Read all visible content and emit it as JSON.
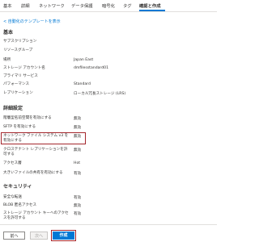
{
  "tabs": [
    "基本",
    "詳細",
    "ネットワーク",
    "データ保護",
    "暗号化",
    "タグ",
    "確認と作成"
  ],
  "template_link": "< 自動化のテンプレートを表示",
  "sections": {
    "basic": "基本",
    "advanced": "詳細設定",
    "security": "セキュリティ"
  },
  "basic_rows": [
    {
      "label": "サブスクリプション",
      "value": ""
    },
    {
      "label": "リソースグループ",
      "value": ""
    },
    {
      "label": "場所",
      "value": "Japan East"
    },
    {
      "label": "ストレージ アカウント名",
      "value": "dmfilesstandard01"
    },
    {
      "label": "プライマリ サービス",
      "value": ""
    },
    {
      "label": "パフォーマンス",
      "value": "Standard"
    },
    {
      "label": "レプリケーション",
      "value": "ローカル冗長ストレージ (LRS)"
    }
  ],
  "advanced_rows": [
    {
      "label": "階層型名前空間を有効にする",
      "value": "無効"
    },
    {
      "label": "SFTP を有効にする",
      "value": "無効"
    },
    {
      "label": "ネットワーク ファイル システム v3 を有効にする",
      "value": "無効"
    },
    {
      "label": "クロステナント レプリケーションを許可する",
      "value": "無効"
    },
    {
      "label": "アクセス層",
      "value": "Hot"
    },
    {
      "label": "大きいファイルの共有を有効にする",
      "value": "有効"
    }
  ],
  "security_rows": [
    {
      "label": "安全な転送",
      "value": "有効"
    },
    {
      "label": "BLOB 匿名アクセス",
      "value": "無効"
    },
    {
      "label": "ストレージ アカウント キーへのアクセスを許可する",
      "value": "有効"
    }
  ],
  "buttons": {
    "previous": "前へ",
    "next": "次へ",
    "create": "作成"
  }
}
